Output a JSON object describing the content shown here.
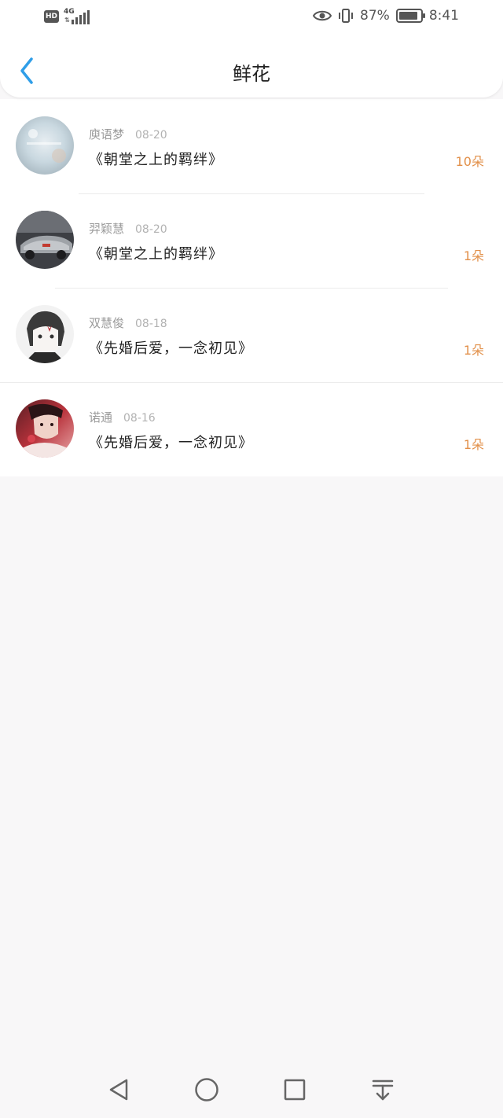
{
  "status_bar": {
    "hd_label": "HD",
    "network": "4G",
    "battery_percent": "87%",
    "battery_level": 0.87,
    "time": "8:41",
    "icons": [
      "eye-icon",
      "vibrate-icon",
      "signal-icon",
      "battery-icon"
    ]
  },
  "header": {
    "title": "鲜花",
    "back_icon": "chevron-left-icon",
    "accent_color": "#2f9ee8"
  },
  "gifts": [
    {
      "user": "庾语梦",
      "date": "08-20",
      "book": "《朝堂之上的羁绊》",
      "count": "10朵"
    },
    {
      "user": "羿颖慧",
      "date": "08-20",
      "book": "《朝堂之上的羁绊》",
      "count": "1朵"
    },
    {
      "user": "双慧俊",
      "date": "08-18",
      "book": "《先婚后爱，一念初见》",
      "count": "1朵"
    },
    {
      "user": "诺通",
      "date": "08-16",
      "book": "《先婚后爱，一念初见》",
      "count": "1朵"
    }
  ],
  "colors": {
    "count": "#e2904a",
    "background": "#f8f7f8"
  },
  "system_nav": [
    "back-triangle-icon",
    "home-circle-icon",
    "recents-square-icon",
    "notification-pulldown-icon"
  ]
}
